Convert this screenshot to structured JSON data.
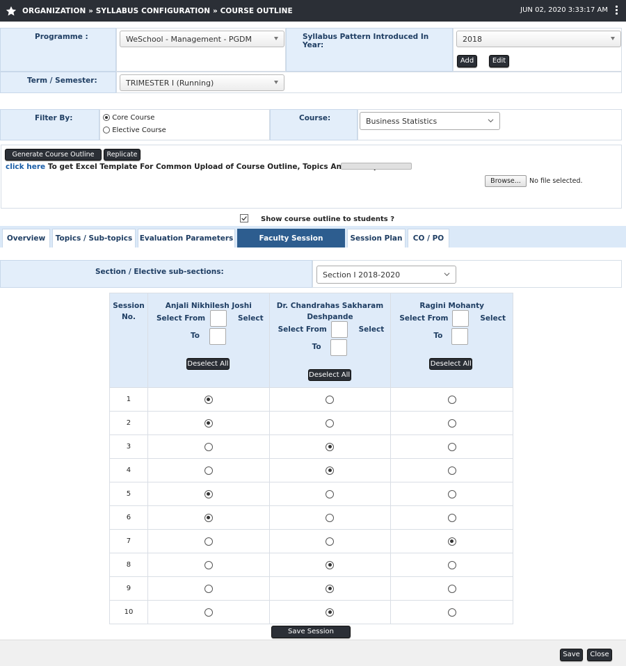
{
  "topbar": {
    "breadcrumb": "ORGANIZATION » SYLLABUS CONFIGURATION » COURSE OUTLINE",
    "datetime": "JUN 02, 2020  3:33:17 AM"
  },
  "form": {
    "programme_label": "Programme :",
    "programme_value": "WeSchool - Management - PGDM",
    "pattern_label": "Syllabus Pattern Introduced In Year:",
    "pattern_value": "2018",
    "add_label": "Add",
    "edit_label": "Edit",
    "term_label": "Term / Semester:",
    "term_value": "TRIMESTER I (Running)"
  },
  "filter": {
    "label": "Filter By:",
    "options": [
      {
        "label": "Core Course",
        "selected": true
      },
      {
        "label": "Elective Course",
        "selected": false
      }
    ],
    "course_label": "Course:",
    "course_value": "Business Statistics"
  },
  "actions": {
    "generate_pdf": "Generate Course Outline PDF",
    "replicate": "Replicate",
    "click_here": "click here",
    "template_text": "To get Excel Template For Common Upload of Course Outline, Topics And Subtopics.",
    "browse": "Browse...",
    "no_file": "No file selected.",
    "show_outline": "Show course outline to students ?"
  },
  "tabs": [
    {
      "label": "Overview",
      "active": false
    },
    {
      "label": "Topics / Sub-topics",
      "active": false
    },
    {
      "label": "Evaluation Parameters",
      "active": false
    },
    {
      "label": "Faculty Session Allocation",
      "active": true
    },
    {
      "label": "Session Plan",
      "active": false
    },
    {
      "label": "CO / PO",
      "active": false
    }
  ],
  "section": {
    "label": "Section / Elective sub-sections:",
    "value": "Section I 2018-2020"
  },
  "allocation": {
    "session_header_1": "Session",
    "session_header_2": "No.",
    "select_from": "Select From",
    "select": "Select",
    "to": "To",
    "deselect_all": "Deselect All",
    "faculty": [
      {
        "line1": "Anjali Nikhilesh Joshi",
        "line2": ""
      },
      {
        "line1": "Dr. Chandrahas Sakharam",
        "line2": "Deshpande"
      },
      {
        "line1": "Ragini Mohanty",
        "line2": ""
      }
    ],
    "sessions": [
      {
        "no": "1",
        "assigned": 0
      },
      {
        "no": "2",
        "assigned": 0
      },
      {
        "no": "3",
        "assigned": 1
      },
      {
        "no": "4",
        "assigned": 1
      },
      {
        "no": "5",
        "assigned": 0
      },
      {
        "no": "6",
        "assigned": 0
      },
      {
        "no": "7",
        "assigned": 2
      },
      {
        "no": "8",
        "assigned": 1
      },
      {
        "no": "9",
        "assigned": 1
      },
      {
        "no": "10",
        "assigned": 1
      }
    ],
    "save_allocation": "Save Session Allocation"
  },
  "footer": {
    "save": "Save",
    "close": "Close"
  }
}
